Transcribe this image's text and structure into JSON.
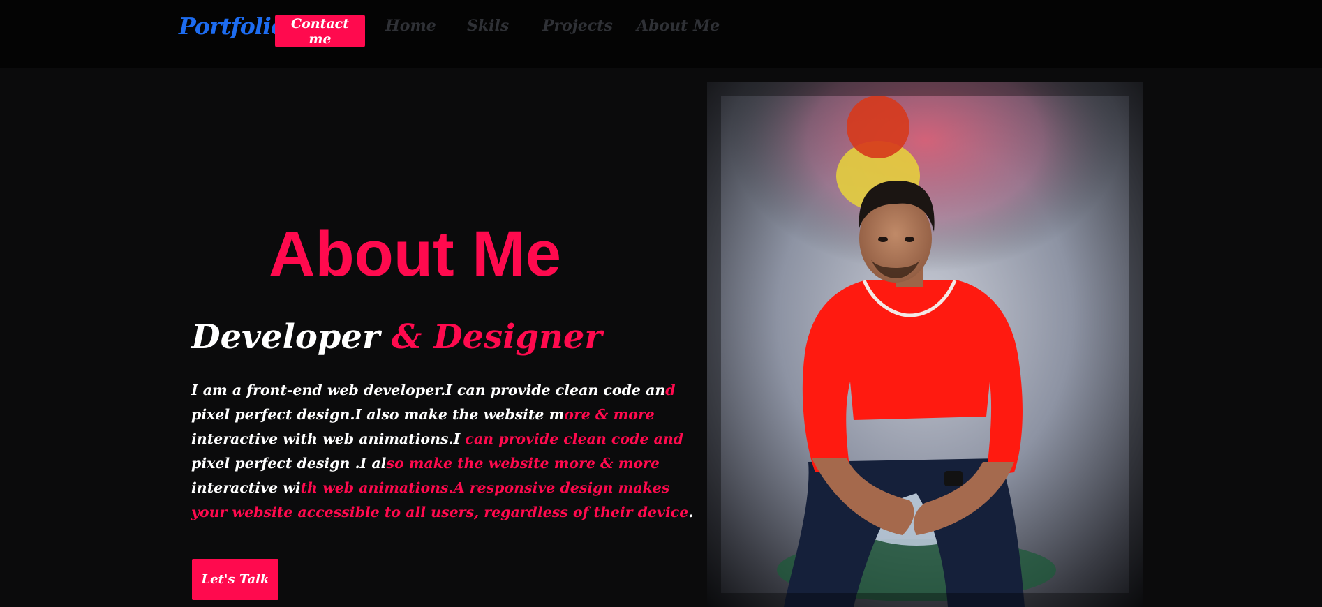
{
  "nav": {
    "brand": "Portfolio",
    "contact_label": "Contact me",
    "links": [
      "Home",
      "Skils",
      "Projects",
      "About Me"
    ]
  },
  "about": {
    "heading": "About Me",
    "subtitle_main": "Developer",
    "subtitle_accent": "& Designer",
    "paragraph_lines": [
      {
        "white": "I am a front-end web developer.I can provide clean code an",
        "pink": "d",
        "tail": ""
      },
      {
        "white": "pixel perfect design.I also make the website m",
        "pink": "ore & more",
        "tail": ""
      },
      {
        "white": "interactive with web animations.I ",
        "pink": "can provide clean code and",
        "tail": ""
      },
      {
        "white": "pixel perfect design .I al",
        "pink": "so make the website more & more",
        "tail": ""
      },
      {
        "white": "interactive wi",
        "pink": "th web animations.A responsive design makes",
        "tail": ""
      },
      {
        "white": "",
        "pink": "your website accessible to all users, regardless of their device",
        "tail": "."
      }
    ],
    "cta_label": "Let's Talk"
  },
  "photo": {
    "subject": "portrait-photo",
    "colors": {
      "shirt": "#ff1a10",
      "jeans": "#15203a",
      "background": "#8a8f9e"
    }
  },
  "colors": {
    "accent": "#ff0a4e",
    "brand": "#1d6cf0",
    "nav_bg": "#040404",
    "page_bg": "#0b0b0c"
  }
}
